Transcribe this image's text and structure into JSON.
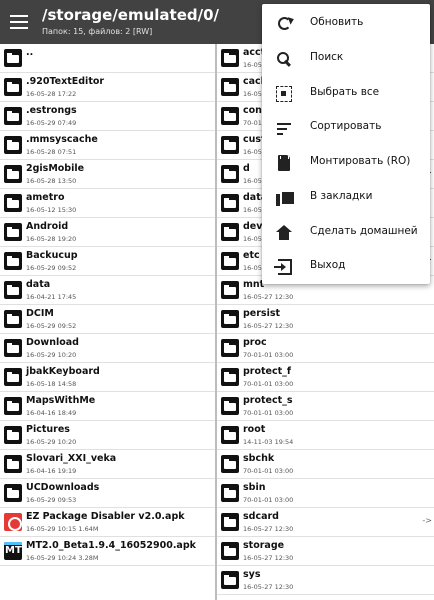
{
  "toolbar": {
    "path": "/storage/emulated/0/",
    "info": "Папок: 15, файлов: 2  [RW]"
  },
  "left_pane": [
    {
      "name": "..",
      "meta": "",
      "icon": "folder-icon"
    },
    {
      "name": ".920TextEditor",
      "meta": "16-05-28 17:22",
      "icon": "folder-icon"
    },
    {
      "name": ".estrongs",
      "meta": "16-05-29 07:49",
      "icon": "folder-icon"
    },
    {
      "name": ".mmsyscache",
      "meta": "16-05-28 07:51",
      "icon": "folder-icon"
    },
    {
      "name": "2gisMobile",
      "meta": "16-05-28 13:50",
      "icon": "folder-icon"
    },
    {
      "name": "ametro",
      "meta": "16-05-12 15:30",
      "icon": "folder-icon"
    },
    {
      "name": "Android",
      "meta": "16-05-28 19:20",
      "icon": "folder-icon"
    },
    {
      "name": "Backucup",
      "meta": "16-05-29 09:52",
      "icon": "folder-icon"
    },
    {
      "name": "data",
      "meta": "16-04-21 17:45",
      "icon": "folder-icon"
    },
    {
      "name": "DCIM",
      "meta": "16-05-29 09:52",
      "icon": "folder-icon"
    },
    {
      "name": "Download",
      "meta": "16-05-29 10:20",
      "icon": "folder-icon"
    },
    {
      "name": "jbakKeyboard",
      "meta": "16-05-18 14:58",
      "icon": "folder-icon"
    },
    {
      "name": "MapsWithMe",
      "meta": "16-04-16 18:49",
      "icon": "folder-icon"
    },
    {
      "name": "Pictures",
      "meta": "16-05-29 10:20",
      "icon": "folder-icon"
    },
    {
      "name": "Slovari_XXI_veka",
      "meta": "16-04-16 19:19",
      "icon": "folder-icon"
    },
    {
      "name": "UCDownloads",
      "meta": "16-05-29 09:53",
      "icon": "folder-icon"
    },
    {
      "name": "EZ Package Disabler v2.0.apk",
      "meta": "16-05-29 10:15  1.64M",
      "icon": "apk-ez-icon"
    },
    {
      "name": "MT2.0_Beta1.9.4_16052900.apk",
      "meta": "16-05-29 10:24  3.28M",
      "icon": "apk-mt-icon"
    }
  ],
  "right_pane": [
    {
      "name": "acct",
      "meta": "16-05-27 12:30",
      "arrow": ""
    },
    {
      "name": "cache",
      "meta": "16-05-29 10:11",
      "arrow": ""
    },
    {
      "name": "config",
      "meta": "70-01-01 03:00",
      "arrow": ""
    },
    {
      "name": "cust",
      "meta": "16-05-27 12:30",
      "arrow": ""
    },
    {
      "name": "d",
      "meta": "16-05-27 12:30",
      "arrow": "->"
    },
    {
      "name": "data",
      "meta": "16-05-27 12:31",
      "arrow": ""
    },
    {
      "name": "dev",
      "meta": "16-05-27 12:31",
      "arrow": ""
    },
    {
      "name": "etc",
      "meta": "16-05-27 12:30",
      "arrow": "->"
    },
    {
      "name": "mnt",
      "meta": "16-05-27 12:30",
      "arrow": ""
    },
    {
      "name": "persist",
      "meta": "16-05-27 12:30",
      "arrow": ""
    },
    {
      "name": "proc",
      "meta": "70-01-01 03:00",
      "arrow": ""
    },
    {
      "name": "protect_f",
      "meta": "70-01-01 03:00",
      "arrow": ""
    },
    {
      "name": "protect_s",
      "meta": "70-01-01 03:00",
      "arrow": ""
    },
    {
      "name": "root",
      "meta": "14-11-03 19:54",
      "arrow": ""
    },
    {
      "name": "sbchk",
      "meta": "70-01-01 03:00",
      "arrow": ""
    },
    {
      "name": "sbin",
      "meta": "70-01-01 03:00",
      "arrow": ""
    },
    {
      "name": "sdcard",
      "meta": "16-05-27 12:30",
      "arrow": "->"
    },
    {
      "name": "storage",
      "meta": "16-05-27 12:30",
      "arrow": ""
    },
    {
      "name": "sys",
      "meta": "16-05-27 12:30",
      "arrow": ""
    }
  ],
  "menu": [
    {
      "label": "Обновить",
      "icon": "refresh-icon"
    },
    {
      "label": "Поиск",
      "icon": "search-icon"
    },
    {
      "label": "Выбрать все",
      "icon": "select-all-icon"
    },
    {
      "label": "Сортировать",
      "icon": "sort-icon"
    },
    {
      "label": "Монтировать (RO)",
      "icon": "sd-card-icon"
    },
    {
      "label": "В закладки",
      "icon": "bookmarks-icon"
    },
    {
      "label": "Сделать домашней",
      "icon": "home-icon"
    },
    {
      "label": "Выход",
      "icon": "exit-icon"
    }
  ]
}
